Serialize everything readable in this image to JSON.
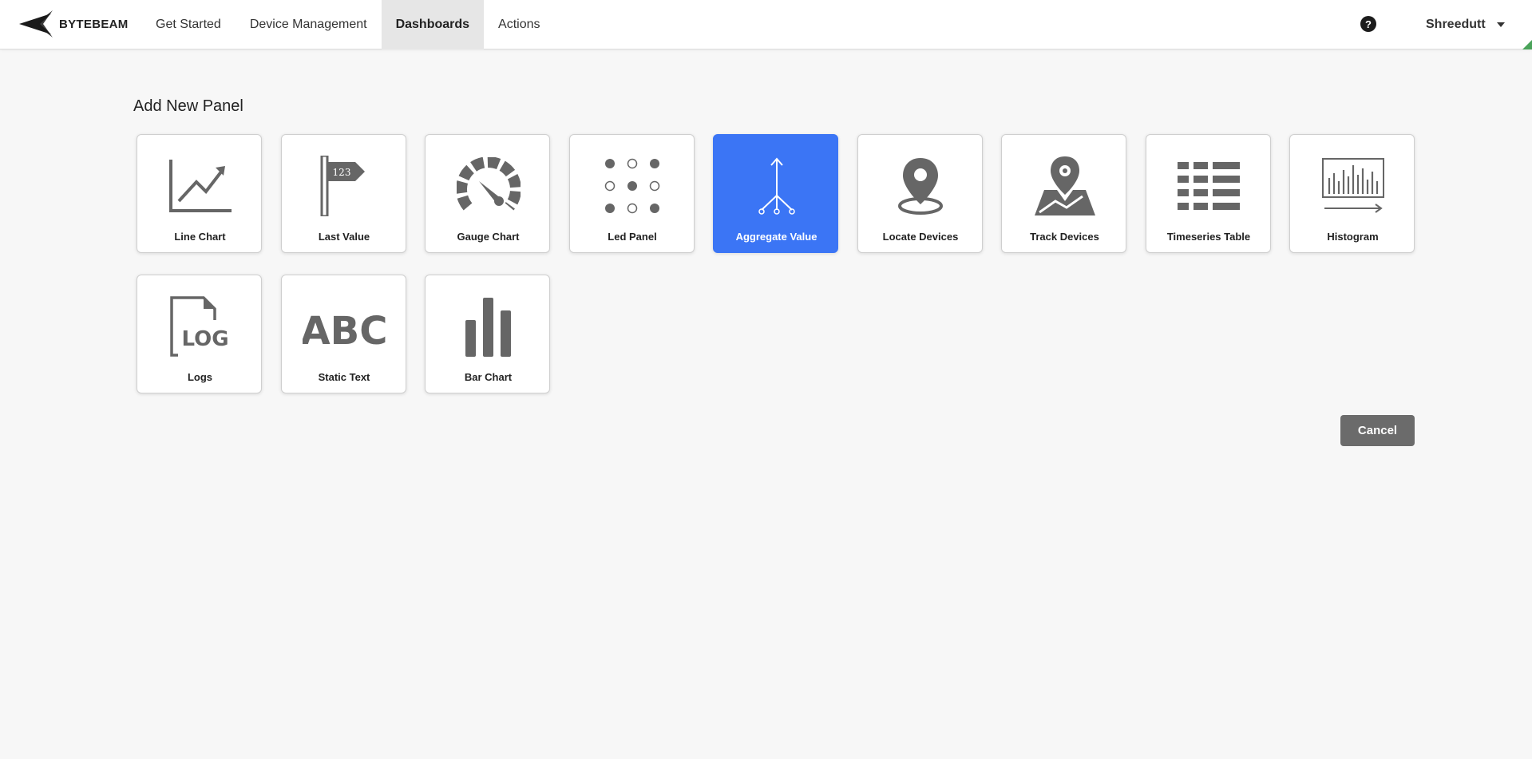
{
  "brand": {
    "name": "BYTEBEAM",
    "logo_icon": "bytebeam-arrow-icon"
  },
  "nav": {
    "items": [
      {
        "label": "Get Started",
        "active": false
      },
      {
        "label": "Device Management",
        "active": false
      },
      {
        "label": "Dashboards",
        "active": true
      },
      {
        "label": "Actions",
        "active": false
      }
    ]
  },
  "header": {
    "help_icon": "question-circle-icon",
    "help_glyph": "?",
    "user_name": "Shreedutt",
    "user_menu_icon": "caret-down-icon"
  },
  "page": {
    "title": "Add New Panel"
  },
  "panels": [
    {
      "label": "Line Chart",
      "icon": "line-chart-icon",
      "selected": false
    },
    {
      "label": "Last Value",
      "icon": "flag-123-icon",
      "icon_text": "123",
      "selected": false
    },
    {
      "label": "Gauge Chart",
      "icon": "gauge-icon",
      "selected": false
    },
    {
      "label": "Led Panel",
      "icon": "led-grid-icon",
      "selected": false
    },
    {
      "label": "Aggregate Value",
      "icon": "aggregate-tree-icon",
      "selected": true
    },
    {
      "label": "Locate Devices",
      "icon": "map-pin-icon",
      "selected": false
    },
    {
      "label": "Track Devices",
      "icon": "map-route-icon",
      "selected": false
    },
    {
      "label": "Timeseries Table",
      "icon": "table-icon",
      "selected": false
    },
    {
      "label": "Histogram",
      "icon": "histogram-icon",
      "selected": false
    },
    {
      "label": "Logs",
      "icon": "log-file-icon",
      "icon_text": "LOG",
      "selected": false
    },
    {
      "label": "Static Text",
      "icon": "abc-text-icon",
      "icon_text": "ABC",
      "selected": false
    },
    {
      "label": "Bar Chart",
      "icon": "bar-chart-icon",
      "selected": false
    }
  ],
  "actions": {
    "cancel_label": "Cancel"
  },
  "colors": {
    "selected_card": "#3b75f5",
    "icon_gray": "#666666",
    "cancel_button": "#6b6b6b",
    "corner_accent": "#4aa35a"
  }
}
